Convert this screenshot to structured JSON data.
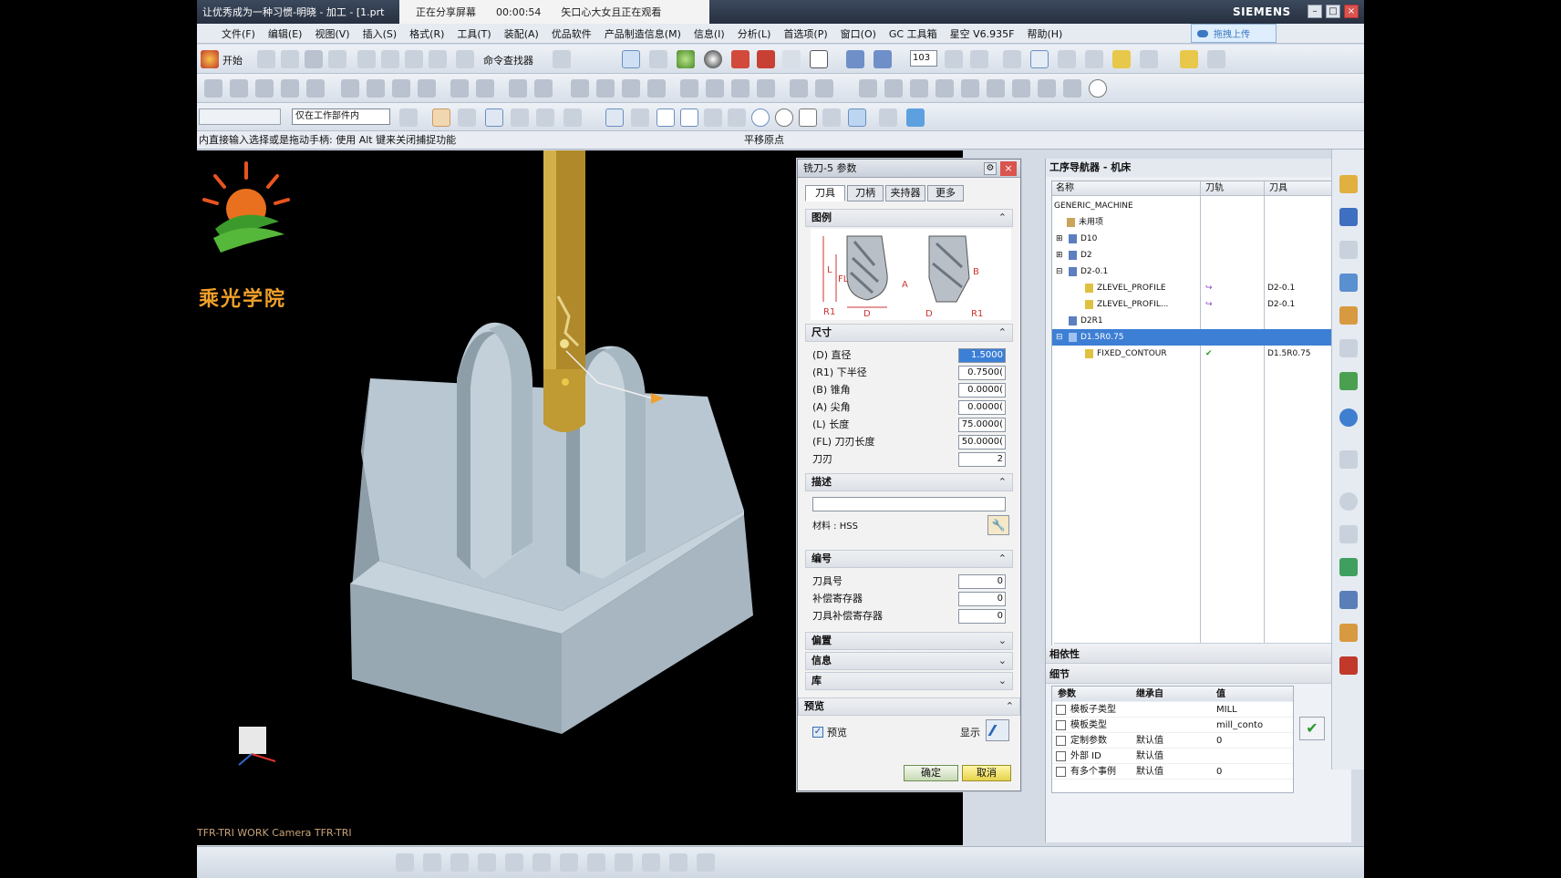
{
  "window": {
    "title": "让优秀成为一种习惯-明晓 - 加工 - [1.prt",
    "share_status": "正在分享屏幕",
    "share_timer": "00:00:54",
    "share_viewer": "矢口心大女且正在观看",
    "brand": "SIEMENS",
    "cloud_button": "拖拽上传"
  },
  "menu": [
    "文件(F)",
    "编辑(E)",
    "视图(V)",
    "插入(S)",
    "格式(R)",
    "工具(T)",
    "装配(A)",
    "优品软件",
    "产品制造信息(M)",
    "信息(I)",
    "分析(L)",
    "首选项(P)",
    "窗口(O)",
    "GC 工具箱",
    "星空 V6.935F",
    "帮助(H)"
  ],
  "toolbar": {
    "start_label": "开始",
    "command_finder": "命令查找器",
    "zoom_value": "103",
    "filter_value": "仅在工作部件内"
  },
  "hint": {
    "text": "内直接输入选择或是拖动手柄: 使用 Alt 键来关闭捕捉功能",
    "secondary": "平移原点"
  },
  "viewport": {
    "logo_text": "乘光学院",
    "camera_text": "TFR-TRI WORK Camera TFR-TRI"
  },
  "dialog": {
    "title": "铣刀-5 参数",
    "tabs": [
      "刀具",
      "刀柄",
      "夹持器",
      "更多"
    ],
    "sections": {
      "legend": "图例",
      "size": "尺寸",
      "desc": "描述",
      "number": "编号",
      "offset": "偏置",
      "info": "信息",
      "library": "库",
      "preview": "预览"
    },
    "size_rows": [
      {
        "label": "(D) 直径",
        "value": "1.5000"
      },
      {
        "label": "(R1) 下半径",
        "value": "0.7500("
      },
      {
        "label": "(B) 锥角",
        "value": "0.0000("
      },
      {
        "label": "(A) 尖角",
        "value": "0.0000("
      },
      {
        "label": "(L) 长度",
        "value": "75.0000("
      },
      {
        "label": "(FL) 刀刃长度",
        "value": "50.0000("
      },
      {
        "label": "刀刃",
        "value": "2"
      }
    ],
    "material": "材料 : HSS",
    "number_rows": [
      {
        "label": "刀具号",
        "value": "0"
      },
      {
        "label": "补偿寄存器",
        "value": "0"
      },
      {
        "label": "刀具补偿寄存器",
        "value": "0"
      }
    ],
    "preview_check": "预览",
    "display_label": "显示",
    "ok": "确定",
    "cancel": "取消",
    "legend_labels": {
      "L": "L",
      "FL": "FL",
      "A": "A",
      "B": "B",
      "R1a": "R1",
      "D": "D",
      "Da": "D",
      "R1b": "R1"
    }
  },
  "navigator": {
    "title": "工序导航器 - 机床",
    "columns": [
      "名称",
      "刀轨",
      "刀具"
    ],
    "rows": [
      {
        "name": "GENERIC_MACHINE",
        "tool": ""
      },
      {
        "name": "未用项",
        "tool": ""
      },
      {
        "name": "D10",
        "tool": ""
      },
      {
        "name": "D2",
        "tool": ""
      },
      {
        "name": "D2-0.1",
        "tool": ""
      },
      {
        "name": "ZLEVEL_PROFILE",
        "tool": "D2-0.1"
      },
      {
        "name": "ZLEVEL_PROFIL...",
        "tool": "D2-0.1"
      },
      {
        "name": "D2R1",
        "tool": ""
      },
      {
        "name": "D1.5R0.75",
        "tool": ""
      },
      {
        "name": "FIXED_CONTOUR",
        "tool": "D1.5R0.75"
      }
    ],
    "dependency": "相依性",
    "details": "细节",
    "detail_columns": [
      "参数",
      "继承自",
      "值"
    ],
    "detail_rows": [
      {
        "param": "模板子类型",
        "from": "",
        "value": "MILL"
      },
      {
        "param": "模板类型",
        "from": "",
        "value": "mill_conto"
      },
      {
        "param": "定制参数",
        "from": "默认值",
        "value": "0"
      },
      {
        "param": "外部 ID",
        "from": "默认值",
        "value": ""
      },
      {
        "param": "有多个事例",
        "from": "默认值",
        "value": "0"
      }
    ]
  }
}
